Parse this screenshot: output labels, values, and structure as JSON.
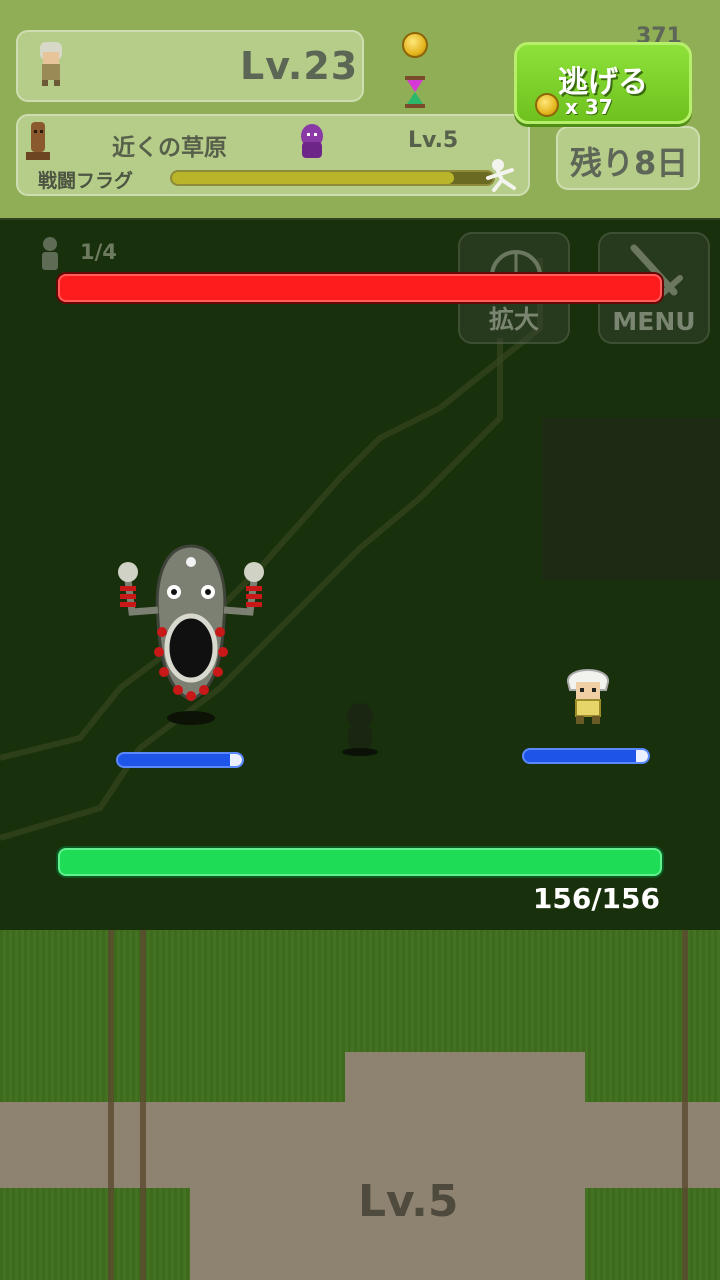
{
  "player": {
    "level_text": "Lv.23"
  },
  "hud": {
    "area_name": "近くの草原",
    "area_level": "Lv.5",
    "flag_label": "戦闘フラグ",
    "flag_progress": 0.88,
    "days_left": "残り8日",
    "top_right_number": "371"
  },
  "escape": {
    "label": "逃げる",
    "coin_count": "x 37"
  },
  "battle": {
    "wave": "1/4",
    "enemy_hp_fraction": 1.0,
    "player_hp_text": "156/156",
    "player_hp_fraction": 1.0,
    "enemy_gauge_fraction": 0.9,
    "hero_gauge_fraction": 0.9
  },
  "buttons": {
    "zoom_label": "拡大",
    "menu_label": "MENU"
  },
  "map": {
    "ground_level_label": "Lv.5"
  },
  "colors": {
    "enemy_hp": "#ff1c1c",
    "player_hp": "#1edc56",
    "escape_button": "#7ad12a",
    "action_gauge": "#1e54e8"
  }
}
